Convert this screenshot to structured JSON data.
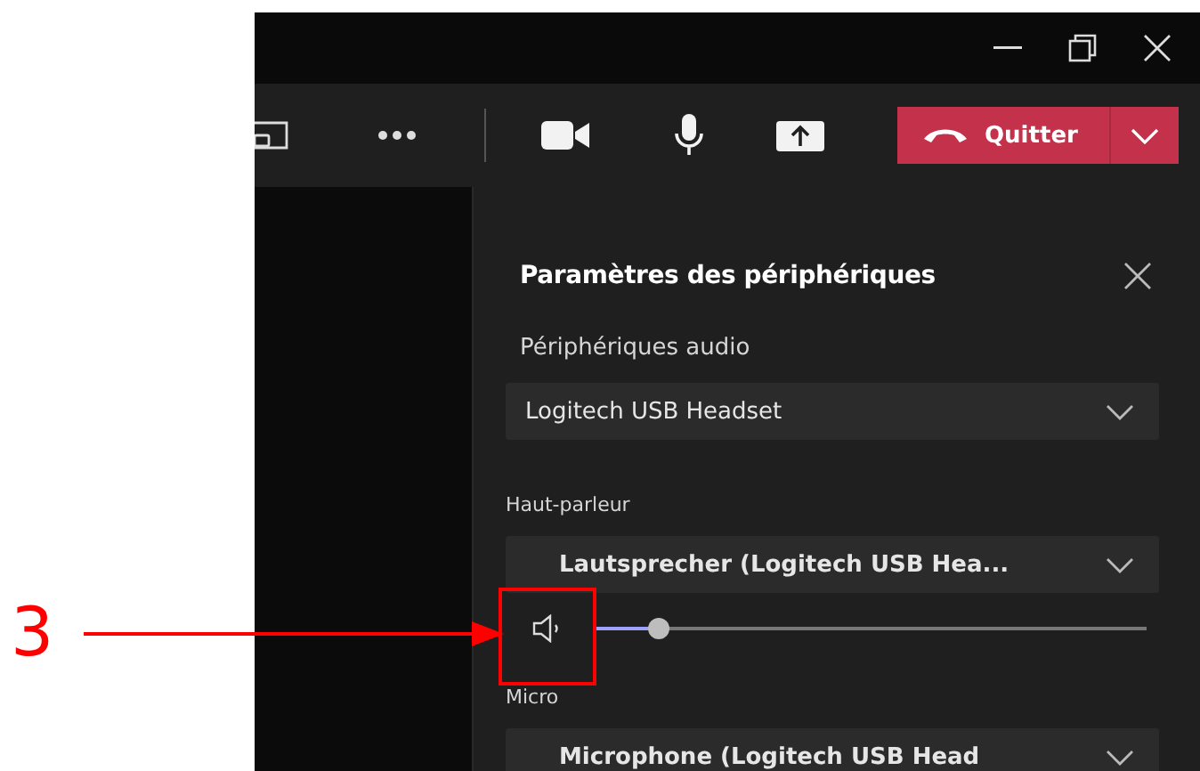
{
  "toolbar": {
    "leave_button": {
      "label": "Quitter"
    }
  },
  "panel": {
    "title": "Paramètres des périphériques",
    "sections": [
      {
        "kind": "dropdown",
        "label": "Périphériques audio",
        "value": "Logitech USB Headset"
      },
      {
        "kind": "dropdown",
        "label": "Haut-parleur",
        "value": "Lautsprecher (Logitech USB Hea..."
      },
      {
        "kind": "slider",
        "level": 0.12
      },
      {
        "kind": "dropdown",
        "label": "Micro",
        "value": "Microphone (Logitech USB Head"
      }
    ]
  },
  "annotation": {
    "label": "3"
  }
}
